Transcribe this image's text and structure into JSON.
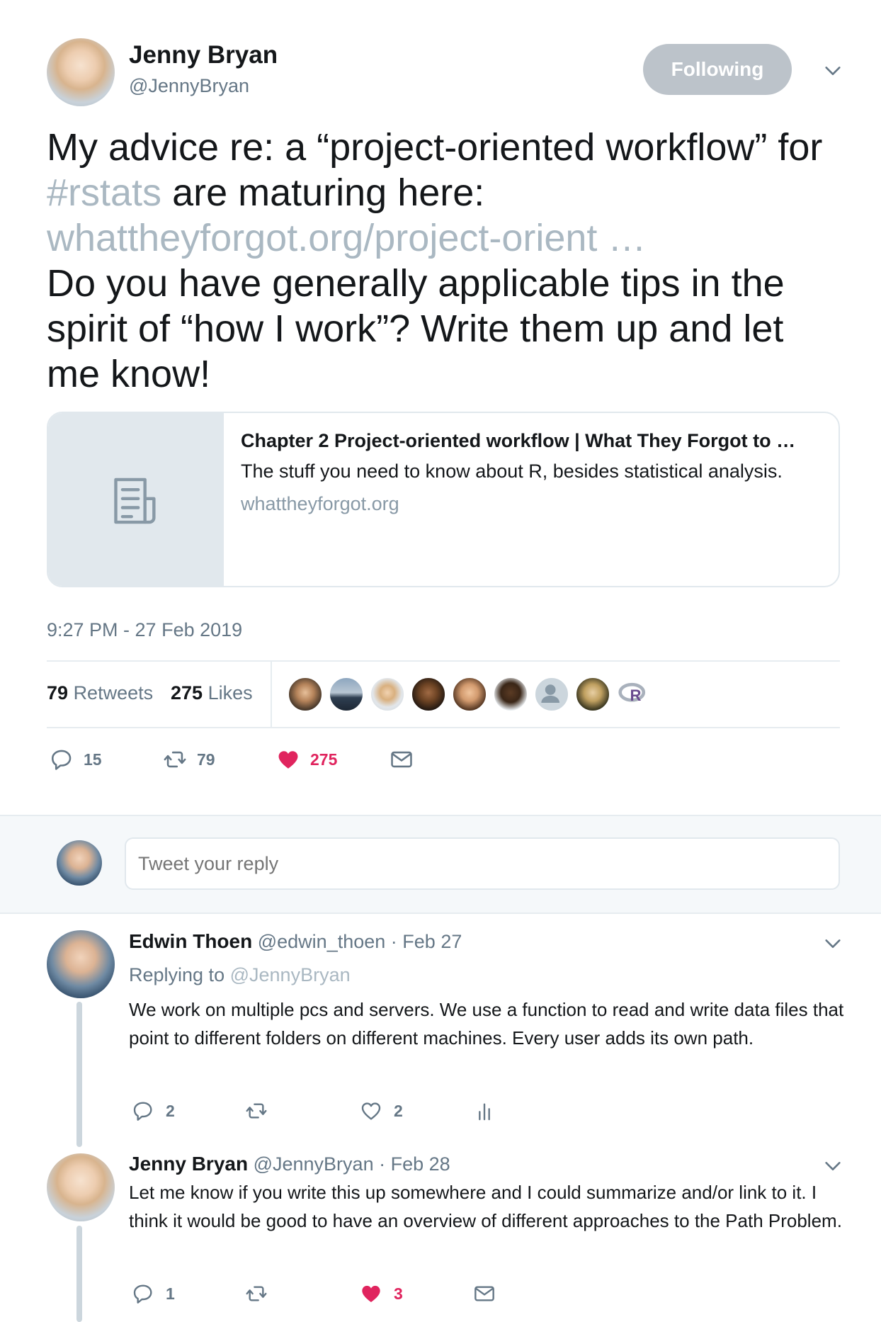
{
  "tweet": {
    "author_name": "Jenny Bryan",
    "author_handle": "@JennyBryan",
    "follow_label": "Following",
    "text_part1": "My advice re: a “project-oriented workflow” for ",
    "hashtag": "#rstats",
    "text_part2": " are maturing here: ",
    "link": "whattheyforgot.org/project-orient …",
    "text_part3": "Do you have generally applicable tips in the spirit of “how I work”? Write them up and let me know!",
    "card": {
      "title": "Chapter 2 Project-oriented workflow | What They Forgot to …",
      "description": "The stuff you need to know about R, besides statistical analysis.",
      "domain": "whattheyforgot.org"
    },
    "timestamp": "9:27 PM - 27 Feb 2019",
    "retweets_count": "79",
    "retweets_label": "Retweets",
    "likes_count": "275",
    "likes_label": "Likes",
    "actions": {
      "replies": "15",
      "retweets": "79",
      "likes": "275"
    }
  },
  "reply_box": {
    "placeholder": "Tweet your reply"
  },
  "replies": [
    {
      "name": "Edwin Thoen",
      "handle": "@edwin_thoen",
      "date": "· Feb 27",
      "replying_prefix": "Replying to",
      "replying_to": "@JennyBryan",
      "text": "We work on multiple pcs and servers. We use a function to read and write data files that point to different folders on different machines. Every user adds its own path.",
      "reply_count": "2",
      "retweet_count": "",
      "like_count": "2"
    },
    {
      "name": "Jenny Bryan",
      "handle": "@JennyBryan",
      "date": "· Feb 28",
      "text": "Let me know if you write this up somewhere and I could summarize and/or link to it. I think it would be good to have an overview of different approaches to the Path Problem.",
      "reply_count": "1",
      "retweet_count": "",
      "like_count": "3"
    }
  ],
  "colors": {
    "text": "#14171a",
    "secondary": "#657786",
    "link_muted": "#aab8c2",
    "like_red": "#e0245e",
    "follow_button": "#bcc3ca",
    "divider": "#e6ecf0"
  }
}
